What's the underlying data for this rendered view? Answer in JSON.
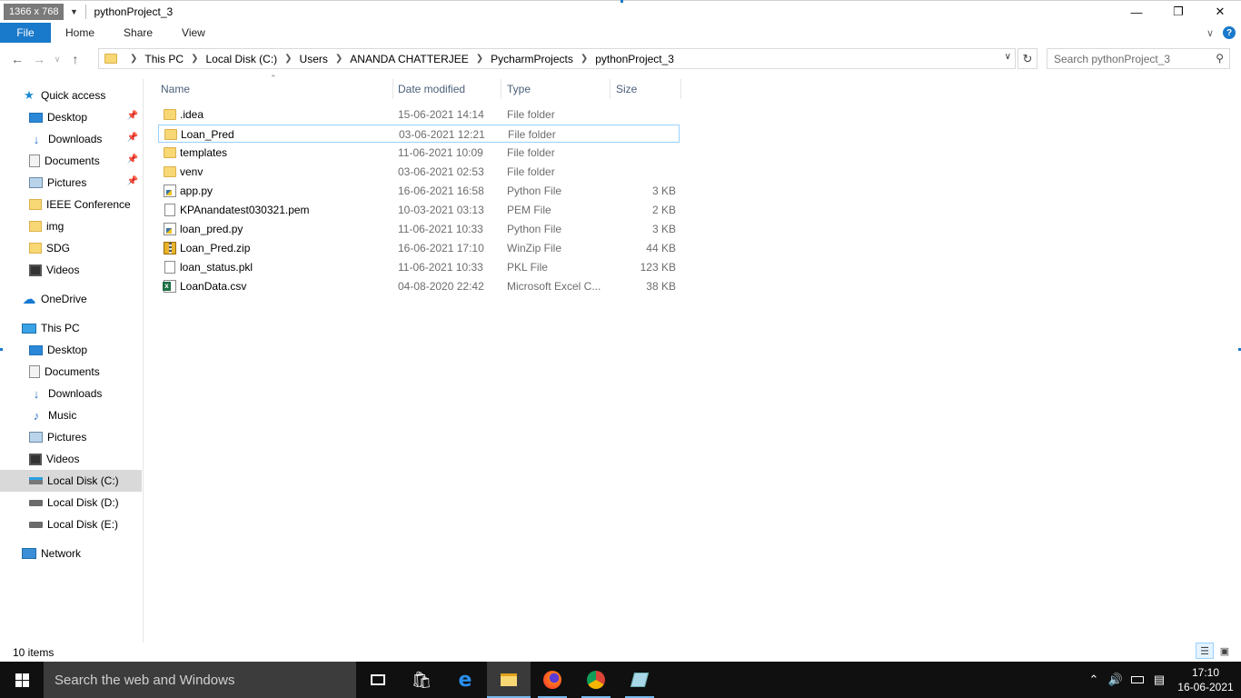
{
  "titlebar": {
    "resolution_badge": "1366 x 768",
    "title": "pythonProject_3",
    "minimize_icon": "minimize-icon",
    "maximize_icon": "restore-icon",
    "close_icon": "close-icon"
  },
  "ribbon": {
    "tabs": [
      {
        "label": "File"
      },
      {
        "label": "Home"
      },
      {
        "label": "Share"
      },
      {
        "label": "View"
      }
    ],
    "expand_icon": "chevron-down-icon",
    "help_icon": "?"
  },
  "address": {
    "crumbs": [
      "This PC",
      "Local Disk (C:)",
      "Users",
      "ANANDA CHATTERJEE",
      "PycharmProjects",
      "pythonProject_3"
    ],
    "search_placeholder": "Search pythonProject_3"
  },
  "sidebar": {
    "quick_access": {
      "label": "Quick access"
    },
    "quick_items": [
      {
        "label": "Desktop",
        "icon": "desktop-icon",
        "pinned": true
      },
      {
        "label": "Downloads",
        "icon": "download-icon",
        "pinned": true
      },
      {
        "label": "Documents",
        "icon": "documents-icon",
        "pinned": true
      },
      {
        "label": "Pictures",
        "icon": "pictures-icon",
        "pinned": true
      },
      {
        "label": "IEEE Conference",
        "icon": "folder-icon",
        "pinned": false
      },
      {
        "label": "img",
        "icon": "folder-icon",
        "pinned": false
      },
      {
        "label": "SDG",
        "icon": "folder-icon",
        "pinned": false
      },
      {
        "label": "Videos",
        "icon": "videos-icon",
        "pinned": false
      }
    ],
    "onedrive": {
      "label": "OneDrive"
    },
    "this_pc": {
      "label": "This PC"
    },
    "pc_items": [
      {
        "label": "Desktop",
        "icon": "desktop-icon"
      },
      {
        "label": "Documents",
        "icon": "documents-icon"
      },
      {
        "label": "Downloads",
        "icon": "download-icon"
      },
      {
        "label": "Music",
        "icon": "music-icon"
      },
      {
        "label": "Pictures",
        "icon": "pictures-icon"
      },
      {
        "label": "Videos",
        "icon": "videos-icon"
      },
      {
        "label": "Local Disk (C:)",
        "icon": "drive-c-icon",
        "selected": true
      },
      {
        "label": "Local Disk (D:)",
        "icon": "drive-icon"
      },
      {
        "label": "Local Disk (E:)",
        "icon": "drive-icon"
      }
    ],
    "network": {
      "label": "Network"
    }
  },
  "columns": {
    "name": "Name",
    "date": "Date modified",
    "type": "Type",
    "size": "Size"
  },
  "files": [
    {
      "name": ".idea",
      "date": "15-06-2021 14:14",
      "type": "File folder",
      "size": "",
      "icon": "folder"
    },
    {
      "name": "Loan_Pred",
      "date": "03-06-2021 12:21",
      "type": "File folder",
      "size": "",
      "icon": "folder",
      "focused": true
    },
    {
      "name": "templates",
      "date": "11-06-2021 10:09",
      "type": "File folder",
      "size": "",
      "icon": "folder"
    },
    {
      "name": "venv",
      "date": "03-06-2021 02:53",
      "type": "File folder",
      "size": "",
      "icon": "folder"
    },
    {
      "name": "app.py",
      "date": "16-06-2021 16:58",
      "type": "Python File",
      "size": "3 KB",
      "icon": "py"
    },
    {
      "name": "KPAnandatest030321.pem",
      "date": "10-03-2021 03:13",
      "type": "PEM File",
      "size": "2 KB",
      "icon": "doc"
    },
    {
      "name": "loan_pred.py",
      "date": "11-06-2021 10:33",
      "type": "Python File",
      "size": "3 KB",
      "icon": "py"
    },
    {
      "name": "Loan_Pred.zip",
      "date": "16-06-2021 17:10",
      "type": "WinZip File",
      "size": "44 KB",
      "icon": "zip"
    },
    {
      "name": "loan_status.pkl",
      "date": "11-06-2021 10:33",
      "type": "PKL File",
      "size": "123 KB",
      "icon": "doc"
    },
    {
      "name": "LoanData.csv",
      "date": "04-08-2020 22:42",
      "type": "Microsoft Excel C...",
      "size": "38 KB",
      "icon": "xls"
    }
  ],
  "status": {
    "item_count": "10 items"
  },
  "taskbar": {
    "search_placeholder": "Search the web and Windows",
    "apps": [
      "task-view",
      "store",
      "edge",
      "file-explorer",
      "firefox",
      "chrome",
      "notepad"
    ],
    "clock_time": "17:10",
    "clock_date": "16-06-2021"
  }
}
